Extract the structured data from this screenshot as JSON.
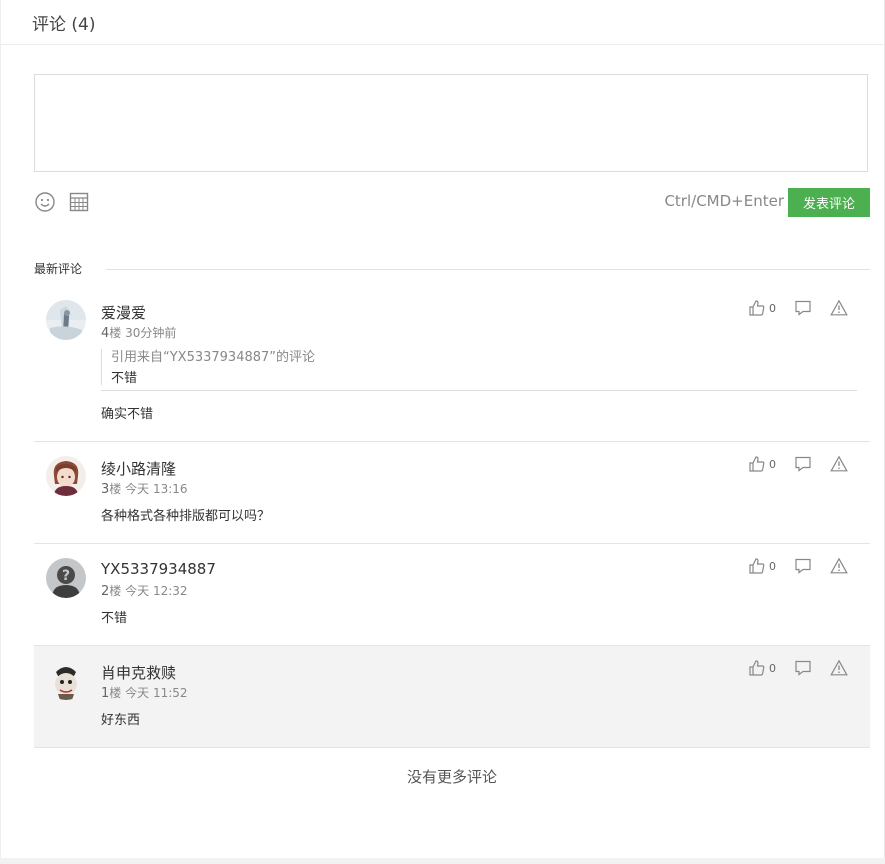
{
  "header": {
    "title": "评论 (4)"
  },
  "editor": {
    "placeholder": "",
    "shortcut": "Ctrl/CMD+Enter",
    "submit_label": "发表评论"
  },
  "section": {
    "title": "最新评论"
  },
  "comments": [
    {
      "username": "爱漫爱",
      "floor": "4",
      "floor_suffix": "楼",
      "time": "30分钟前",
      "quote": {
        "source": "引用来自“YX5337934887”的评论",
        "text": "不错"
      },
      "text": "确实不错",
      "likes": "0"
    },
    {
      "username": "绫小路清隆",
      "floor": "3",
      "floor_suffix": "楼",
      "time": "今天 13:16",
      "text": "各种格式各种排版都可以吗？",
      "likes": "0"
    },
    {
      "username": "YX5337934887",
      "floor": "2",
      "floor_suffix": "楼",
      "time": "今天 12:32",
      "text": "不错",
      "likes": "0"
    },
    {
      "username": "肖申克救赎",
      "floor": "1",
      "floor_suffix": "楼",
      "time": "今天 11:52",
      "text": "好东西",
      "likes": "0"
    }
  ],
  "footer": {
    "no_more": "没有更多评论"
  },
  "colors": {
    "accent": "#4caf50",
    "highlight_row": "#f3f3f3"
  },
  "icons": [
    "emoji-icon",
    "grid-icon",
    "thumbs-up-icon",
    "reply-icon",
    "report-icon"
  ]
}
